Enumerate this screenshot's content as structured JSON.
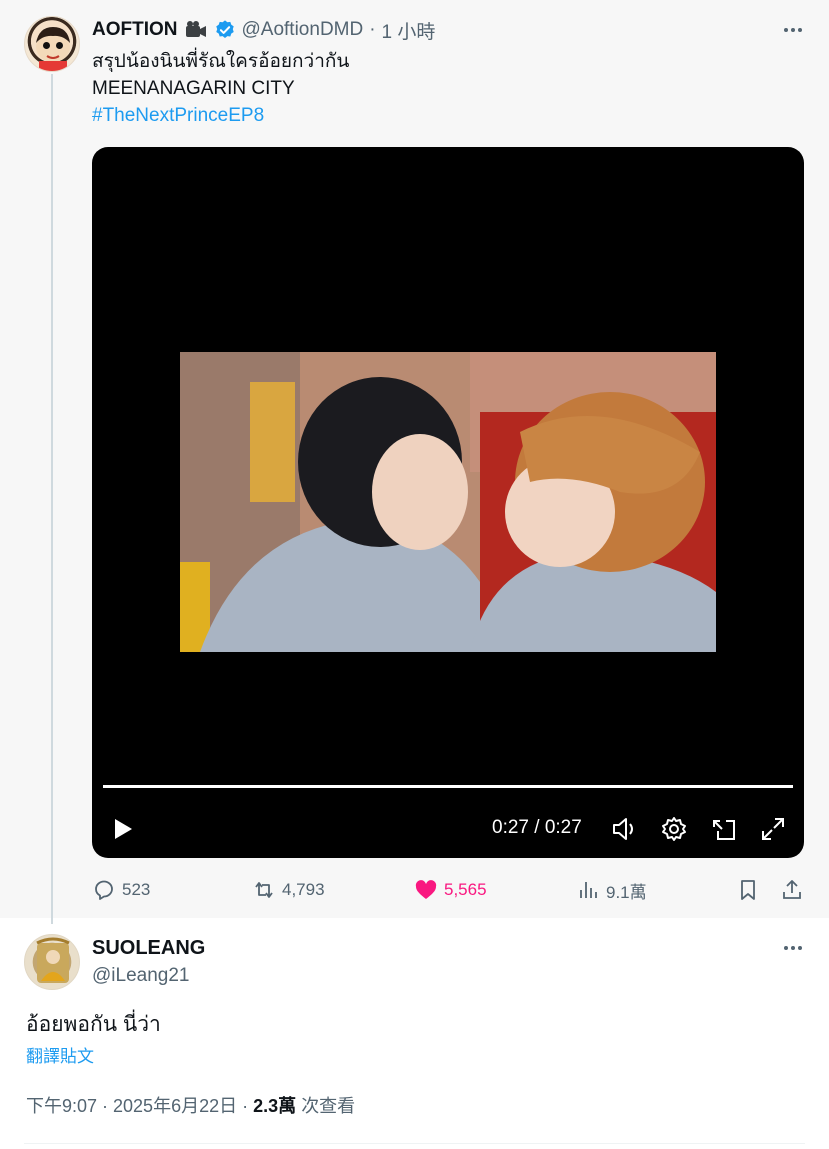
{
  "parent_tweet": {
    "display_name": "AOFTION",
    "handle": "@AoftionDMD",
    "separator": "·",
    "time": "1 小時",
    "text_line_1": "สรุปน้องนินพี่รัณใครอ้อยกว่ากัน",
    "text_line_2": "MEENANAGARIN CITY",
    "hashtag": "#TheNextPrinceEP8",
    "video": {
      "time_display": "0:27 / 0:27",
      "progress": 1.0
    },
    "actions": {
      "replies": "523",
      "reposts": "4,793",
      "likes": "5,565",
      "views": "9.1萬"
    }
  },
  "reply_tweet": {
    "display_name": "SUOLEANG",
    "handle": "@iLeang21",
    "text": "อ้อยพอกัน นี่ว่า",
    "translate_label": "翻譯貼文",
    "timestamp": "下午9:07 · 2025年6月22日",
    "separator": "·",
    "views_count": "2.3萬",
    "views_label": "次查看"
  },
  "colors": {
    "accent": "#1d9bf0",
    "like": "#f91880",
    "muted": "#536471"
  },
  "icons": [
    "camera-icon",
    "verified-icon",
    "more-icon",
    "play-icon",
    "volume-icon",
    "settings-icon",
    "pip-icon",
    "fullscreen-icon",
    "reply-icon",
    "repost-icon",
    "heart-icon",
    "views-icon",
    "bookmark-icon",
    "share-icon"
  ]
}
